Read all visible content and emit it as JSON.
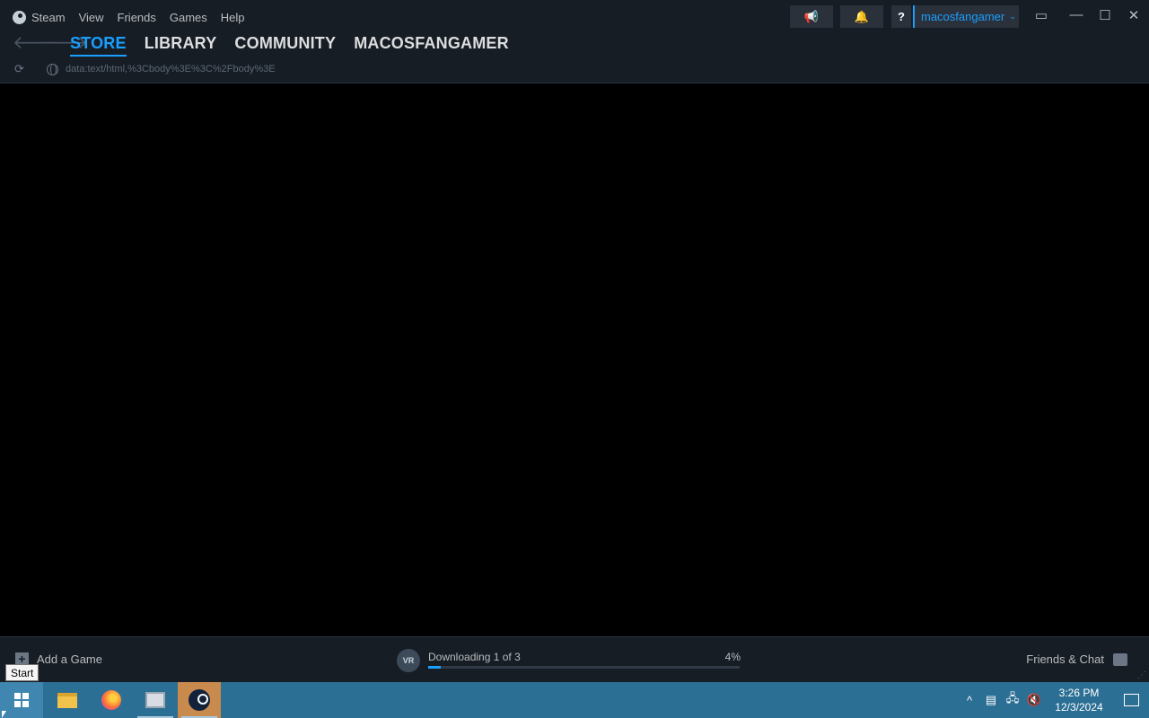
{
  "menu": [
    "Steam",
    "View",
    "Friends",
    "Games",
    "Help"
  ],
  "nav_tabs": [
    "STORE",
    "LIBRARY",
    "COMMUNITY",
    "MACOSFANGAMER"
  ],
  "url": "data:text/html,%3Cbody%3E%3C%2Fbody%3E",
  "account": {
    "username": "macosfangamer",
    "help_label": "?"
  },
  "footer": {
    "add_game": "Add a Game",
    "download_icon_text": "VR",
    "download_status": "Downloading 1 of 3",
    "download_percent": "4%",
    "download_progress": 0.04,
    "friends_chat": "Friends & Chat"
  },
  "tooltip": "Start",
  "clock": {
    "time": "3:26 PM",
    "date": "12/3/2024"
  },
  "colors": {
    "accent": "#1a9fff",
    "header_bg": "#171d25",
    "taskbar_bg": "#2c6f94"
  }
}
